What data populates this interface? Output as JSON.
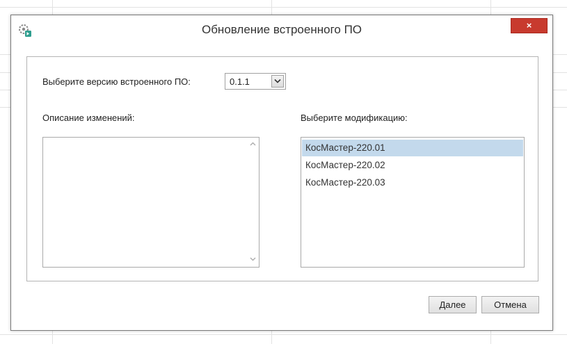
{
  "dialog": {
    "title": "Обновление встроенного ПО",
    "close_symbol": "×"
  },
  "firmware": {
    "version_label": "Выберите версию встроенного ПО:",
    "selected_version": "0.1.1"
  },
  "changes": {
    "label": "Описание изменений:",
    "text": ""
  },
  "modifications": {
    "label": "Выберите модификацию:",
    "items": [
      "КосМастер-220.01",
      "КосМастер-220.02",
      "КосМастер-220.03"
    ],
    "selected_index": 0
  },
  "buttons": {
    "next": "Далее",
    "cancel": "Отмена"
  },
  "icons": {
    "app": "firmware-update-icon",
    "close": "close-icon",
    "dropdown": "chevron-down-icon",
    "scroll_up": "scroll-up-icon",
    "scroll_down": "scroll-down-icon"
  },
  "colors": {
    "close_button": "#c83a2e",
    "selection": "#c3d9ec",
    "icon_teal": "#2f9e8f"
  }
}
